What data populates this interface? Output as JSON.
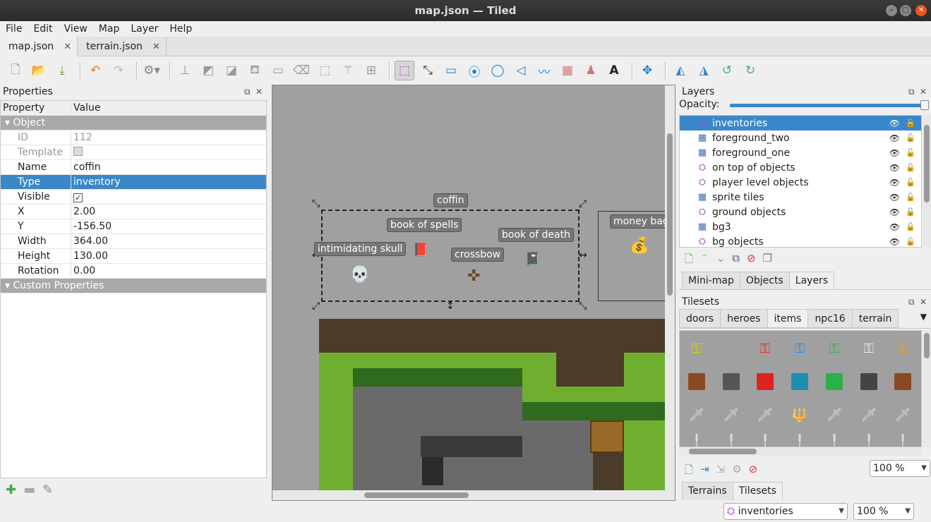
{
  "window": {
    "title": "map.json — Tiled"
  },
  "menu": [
    "File",
    "Edit",
    "View",
    "Map",
    "Layer",
    "Help"
  ],
  "doc_tabs": [
    {
      "label": "map.json",
      "active": true
    },
    {
      "label": "terrain.json",
      "active": false
    }
  ],
  "properties": {
    "title": "Properties",
    "col_property": "Property",
    "col_value": "Value",
    "group_object": "Object",
    "rows": [
      {
        "key": "ID",
        "value": "112"
      },
      {
        "key": "Template",
        "value": ""
      },
      {
        "key": "Name",
        "value": "coffin"
      },
      {
        "key": "Type",
        "value": "inventory"
      },
      {
        "key": "Visible",
        "value": "✓"
      },
      {
        "key": "X",
        "value": "2.00"
      },
      {
        "key": "Y",
        "value": "-156.50"
      },
      {
        "key": "Width",
        "value": "364.00"
      },
      {
        "key": "Height",
        "value": "130.00"
      },
      {
        "key": "Rotation",
        "value": "0.00"
      }
    ],
    "group_custom": "Custom Properties"
  },
  "map_objects": {
    "coffin": "coffin",
    "book_of_spells": "book of spells",
    "book_of_death": "book of death",
    "intimidating_skull": "intimidating skull",
    "crossbow": "crossbow",
    "money_bag": "money bag"
  },
  "layers": {
    "title": "Layers",
    "opacity_label": "Opacity:",
    "items": [
      {
        "name": "inventories",
        "type": "object",
        "selected": true
      },
      {
        "name": "foreground_two",
        "type": "tile"
      },
      {
        "name": "foreground_one",
        "type": "tile"
      },
      {
        "name": "on top of objects",
        "type": "object"
      },
      {
        "name": "player level objects",
        "type": "object"
      },
      {
        "name": "sprite tiles",
        "type": "tile"
      },
      {
        "name": "ground objects",
        "type": "object"
      },
      {
        "name": "bg3",
        "type": "tile"
      },
      {
        "name": "bg objects",
        "type": "object"
      }
    ],
    "panel_tabs": [
      "Mini-map",
      "Objects",
      "Layers"
    ]
  },
  "tilesets": {
    "title": "Tilesets",
    "tabs": [
      "doors",
      "heroes",
      "items",
      "npc16",
      "terrain"
    ],
    "active_tab": "items",
    "zoom": "100 %",
    "bottom_tabs": [
      "Terrains",
      "Tilesets"
    ]
  },
  "status": {
    "layer_select": "inventories",
    "zoom": "100 %"
  },
  "colors": {
    "selection": "#3a87c9",
    "canvas_bg": "#a0a0a0",
    "group_header": "#a9a9a9"
  }
}
